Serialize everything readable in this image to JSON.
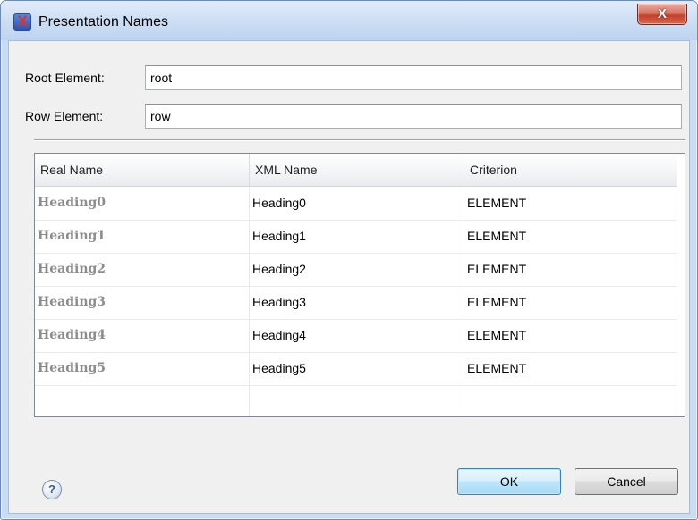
{
  "window": {
    "title": "Presentation Names",
    "close_glyph": "X"
  },
  "form": {
    "root_label": "Root Element:",
    "root_value": "root",
    "row_label": "Row Element:",
    "row_value": "row"
  },
  "table": {
    "columns": [
      "Real Name",
      "XML Name",
      "Criterion"
    ],
    "rows": [
      {
        "real": "Heading0",
        "xml": "Heading0",
        "criterion": "ELEMENT"
      },
      {
        "real": "Heading1",
        "xml": "Heading1",
        "criterion": "ELEMENT"
      },
      {
        "real": "Heading2",
        "xml": "Heading2",
        "criterion": "ELEMENT"
      },
      {
        "real": "Heading3",
        "xml": "Heading3",
        "criterion": "ELEMENT"
      },
      {
        "real": "Heading4",
        "xml": "Heading4",
        "criterion": "ELEMENT"
      },
      {
        "real": "Heading5",
        "xml": "Heading5",
        "criterion": "ELEMENT"
      },
      {
        "real": "",
        "xml": "",
        "criterion": ""
      }
    ]
  },
  "footer": {
    "help_glyph": "?",
    "ok_label": "OK",
    "cancel_label": "Cancel"
  },
  "icons": {
    "app": "oxygen-x-icon",
    "close": "close-icon",
    "help": "help-icon"
  },
  "colors": {
    "accent": "#3c7fb1",
    "close_button": "#c4402b",
    "real_name_text": "#8c8c8c"
  }
}
